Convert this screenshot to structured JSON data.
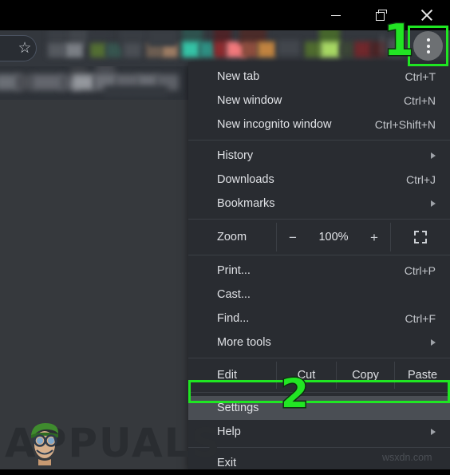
{
  "window": {
    "controls": [
      {
        "name": "minimize",
        "label": "Minimize"
      },
      {
        "name": "restore",
        "label": "Restore"
      },
      {
        "name": "close",
        "label": "Close"
      }
    ]
  },
  "toolbar": {
    "bookmark_star_glyph": "☆",
    "kebab_button_label": "Customize and control Google Chrome"
  },
  "menu": {
    "groups": [
      {
        "items": [
          {
            "label": "New tab",
            "accel": "Ctrl+T",
            "submenu": false
          },
          {
            "label": "New window",
            "accel": "Ctrl+N",
            "submenu": false
          },
          {
            "label": "New incognito window",
            "accel": "Ctrl+Shift+N",
            "submenu": false
          }
        ]
      },
      {
        "items": [
          {
            "label": "History",
            "accel": "",
            "submenu": true
          },
          {
            "label": "Downloads",
            "accel": "Ctrl+J",
            "submenu": false
          },
          {
            "label": "Bookmarks",
            "accel": "",
            "submenu": true
          }
        ]
      }
    ],
    "zoom": {
      "label": "Zoom",
      "minus": "−",
      "value": "100%",
      "plus": "+",
      "fullscreen_icon": "fullscreen-icon"
    },
    "tools_group": [
      {
        "label": "Print...",
        "accel": "Ctrl+P",
        "submenu": false
      },
      {
        "label": "Cast...",
        "accel": "",
        "submenu": false
      },
      {
        "label": "Find...",
        "accel": "Ctrl+F",
        "submenu": false
      },
      {
        "label": "More tools",
        "accel": "",
        "submenu": true
      }
    ],
    "edit_row": {
      "label": "Edit",
      "cut": "Cut",
      "copy": "Copy",
      "paste": "Paste"
    },
    "settings_group": [
      {
        "label": "Settings",
        "accel": "",
        "submenu": false,
        "highlighted": true
      },
      {
        "label": "Help",
        "accel": "",
        "submenu": true,
        "highlighted": false
      }
    ],
    "exit_group": [
      {
        "label": "Exit",
        "accel": "",
        "submenu": false
      }
    ]
  },
  "annotations": {
    "step_one": "1",
    "step_two": "2",
    "highlight_color": "#1fe622"
  },
  "watermarks": {
    "brand": "APPUALS",
    "site": "wsxdn.com"
  }
}
